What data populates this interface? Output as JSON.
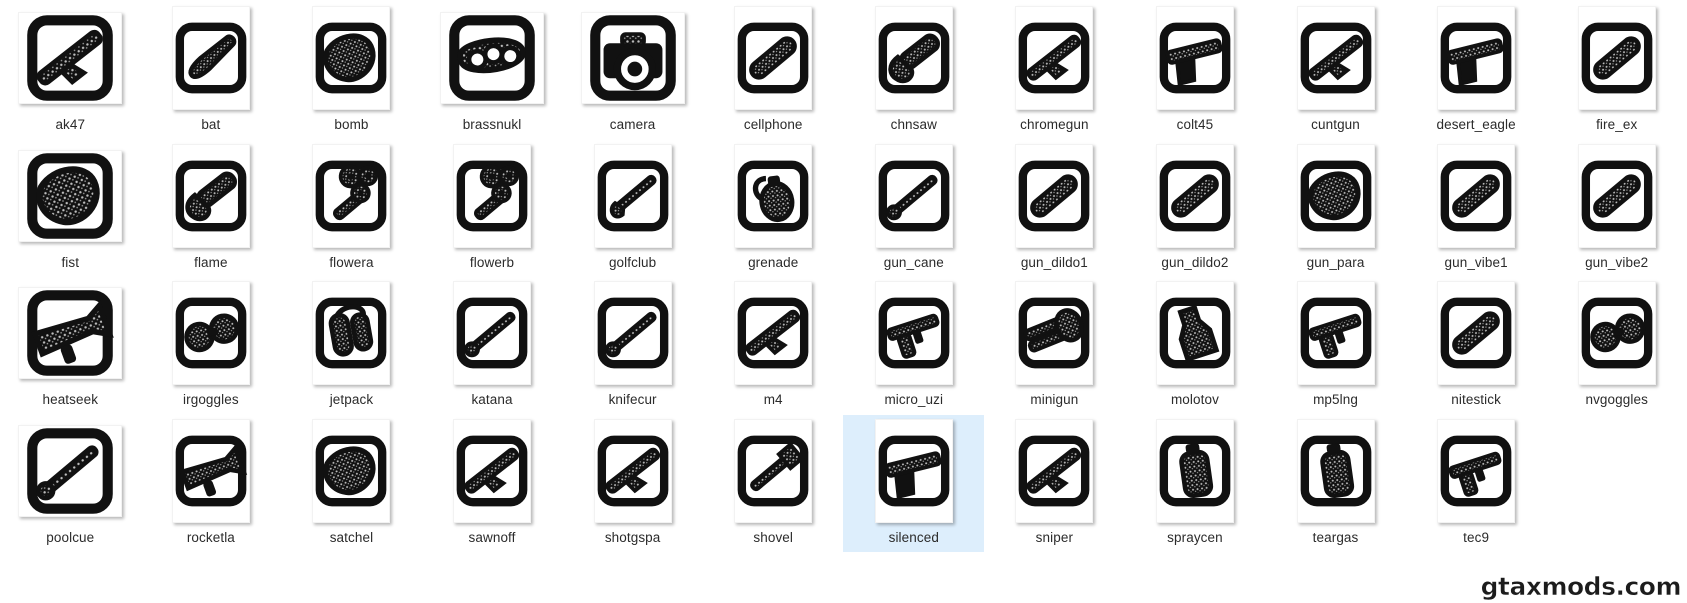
{
  "view": {
    "type": "icon-grid",
    "columns": 12,
    "rows": 4,
    "background_color": "#ffffff",
    "selection_color": "#ddeefc",
    "label_color": "#2b2b2b",
    "icon_color": "#111111"
  },
  "watermark": {
    "text": "gtaxmods.com"
  },
  "items": [
    {
      "label": "ak47",
      "icon": "rifle-icon",
      "shape": "diagonal-rifle",
      "selected": false
    },
    {
      "label": "bat",
      "icon": "baseball-bat-icon",
      "shape": "diagonal-bat",
      "selected": false
    },
    {
      "label": "bomb",
      "icon": "bomb-icon",
      "shape": "blob",
      "selected": false
    },
    {
      "label": "brassnukl",
      "icon": "brass-knuckles-icon",
      "shape": "rings",
      "selected": false
    },
    {
      "label": "camera",
      "icon": "camera-icon",
      "shape": "camera",
      "selected": false
    },
    {
      "label": "cellphone",
      "icon": "cellphone-icon",
      "shape": "diagonal-bar",
      "selected": false
    },
    {
      "label": "chnsaw",
      "icon": "chainsaw-icon",
      "shape": "chainsaw",
      "selected": false
    },
    {
      "label": "chromegun",
      "icon": "shotgun-icon",
      "shape": "diagonal-rifle",
      "selected": false
    },
    {
      "label": "colt45",
      "icon": "pistol-icon",
      "shape": "pistol",
      "selected": false
    },
    {
      "label": "cuntgun",
      "icon": "sawn-off-shotgun-icon",
      "shape": "diagonal-rifle",
      "selected": false
    },
    {
      "label": "desert_eagle",
      "icon": "pistol-icon",
      "shape": "pistol",
      "selected": false
    },
    {
      "label": "fire_ex",
      "icon": "fire-extinguisher-icon",
      "shape": "diagonal-bar",
      "selected": false
    },
    {
      "label": "fist",
      "icon": "fist-icon",
      "shape": "blob",
      "selected": false
    },
    {
      "label": "flame",
      "icon": "flamethrower-icon",
      "shape": "chainsaw",
      "selected": false
    },
    {
      "label": "flowera",
      "icon": "flowers-icon",
      "shape": "flowers",
      "selected": false
    },
    {
      "label": "flowerb",
      "icon": "flowers-icon",
      "shape": "flowers",
      "selected": false
    },
    {
      "label": "golfclub",
      "icon": "golf-club-icon",
      "shape": "golfclub",
      "selected": false
    },
    {
      "label": "grenade",
      "icon": "grenade-icon",
      "shape": "grenade",
      "selected": false
    },
    {
      "label": "gun_cane",
      "icon": "cane-icon",
      "shape": "diagonal-thin",
      "selected": false
    },
    {
      "label": "gun_dildo1",
      "icon": "dildo-icon",
      "shape": "diagonal-bar",
      "selected": false
    },
    {
      "label": "gun_dildo2",
      "icon": "dildo-icon",
      "shape": "diagonal-bar",
      "selected": false
    },
    {
      "label": "gun_para",
      "icon": "parachute-icon",
      "shape": "blob",
      "selected": false
    },
    {
      "label": "gun_vibe1",
      "icon": "vibrator-icon",
      "shape": "diagonal-bar",
      "selected": false
    },
    {
      "label": "gun_vibe2",
      "icon": "vibrator-icon",
      "shape": "diagonal-bar",
      "selected": false
    },
    {
      "label": "heatseek",
      "icon": "rocket-launcher-icon",
      "shape": "launcher",
      "selected": false
    },
    {
      "label": "irgoggles",
      "icon": "goggles-icon",
      "shape": "goggles",
      "selected": false
    },
    {
      "label": "jetpack",
      "icon": "jetpack-icon",
      "shape": "jetpack",
      "selected": false
    },
    {
      "label": "katana",
      "icon": "katana-icon",
      "shape": "diagonal-thin",
      "selected": false
    },
    {
      "label": "knifecur",
      "icon": "knife-icon",
      "shape": "diagonal-thin",
      "selected": false
    },
    {
      "label": "m4",
      "icon": "assault-rifle-icon",
      "shape": "diagonal-rifle",
      "selected": false
    },
    {
      "label": "micro_uzi",
      "icon": "uzi-icon",
      "shape": "smg",
      "selected": false
    },
    {
      "label": "minigun",
      "icon": "minigun-icon",
      "shape": "minigun",
      "selected": false
    },
    {
      "label": "molotov",
      "icon": "molotov-icon",
      "shape": "bottle",
      "selected": false
    },
    {
      "label": "mp5lng",
      "icon": "submachine-gun-icon",
      "shape": "smg",
      "selected": false
    },
    {
      "label": "nitestick",
      "icon": "night-stick-icon",
      "shape": "diagonal-bar",
      "selected": false
    },
    {
      "label": "nvgoggles",
      "icon": "goggles-icon",
      "shape": "goggles",
      "selected": false
    },
    {
      "label": "poolcue",
      "icon": "pool-cue-icon",
      "shape": "diagonal-thin",
      "selected": false
    },
    {
      "label": "rocketla",
      "icon": "rocket-launcher-icon",
      "shape": "launcher",
      "selected": false
    },
    {
      "label": "satchel",
      "icon": "satchel-charge-icon",
      "shape": "blob",
      "selected": false
    },
    {
      "label": "sawnoff",
      "icon": "sawn-off-shotgun-icon",
      "shape": "diagonal-rifle",
      "selected": false
    },
    {
      "label": "shotgspa",
      "icon": "combat-shotgun-icon",
      "shape": "diagonal-rifle",
      "selected": false
    },
    {
      "label": "shovel",
      "icon": "shovel-icon",
      "shape": "shovel",
      "selected": false
    },
    {
      "label": "silenced",
      "icon": "silenced-pistol-icon",
      "shape": "pistol",
      "selected": true
    },
    {
      "label": "sniper",
      "icon": "sniper-rifle-icon",
      "shape": "diagonal-rifle",
      "selected": false
    },
    {
      "label": "spraycen",
      "icon": "spray-can-icon",
      "shape": "spraycan",
      "selected": false
    },
    {
      "label": "teargas",
      "icon": "tear-gas-icon",
      "shape": "spraycan",
      "selected": false
    },
    {
      "label": "tec9",
      "icon": "tec9-icon",
      "shape": "smg",
      "selected": false
    }
  ]
}
